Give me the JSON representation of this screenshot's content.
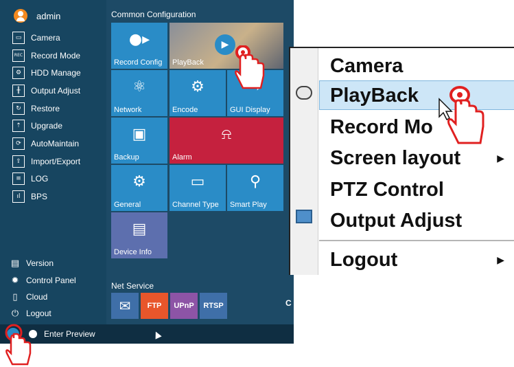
{
  "user": {
    "name": "admin"
  },
  "sidebar": {
    "items": [
      {
        "label": "Camera",
        "icon": "camera-icon",
        "glyph": "▭"
      },
      {
        "label": "Record Mode",
        "icon": "rec-icon",
        "glyph": "REC"
      },
      {
        "label": "HDD Manage",
        "icon": "hdd-icon",
        "glyph": "⚙"
      },
      {
        "label": "Output Adjust",
        "icon": "sliders-icon",
        "glyph": "╫"
      },
      {
        "label": "Restore",
        "icon": "restore-icon",
        "glyph": "↻"
      },
      {
        "label": "Upgrade",
        "icon": "upgrade-icon",
        "glyph": "⇡"
      },
      {
        "label": "AutoMaintain",
        "icon": "automaintain-icon",
        "glyph": "⟳"
      },
      {
        "label": "Import/Export",
        "icon": "import-export-icon",
        "glyph": "⇪"
      },
      {
        "label": "LOG",
        "icon": "log-icon",
        "glyph": "≡"
      },
      {
        "label": "BPS",
        "icon": "bps-icon",
        "glyph": "ıl"
      }
    ],
    "bottom": [
      {
        "label": "Version",
        "icon": "version-icon",
        "glyph": "▤"
      },
      {
        "label": "Control Panel",
        "icon": "gear-icon",
        "glyph": "✹"
      },
      {
        "label": "Cloud",
        "icon": "cloud-icon",
        "glyph": "▯"
      },
      {
        "label": "Logout",
        "icon": "power-icon",
        "glyph": "⏻"
      }
    ]
  },
  "common": {
    "title": "Common Configuration",
    "tiles": [
      {
        "label": "Record Config",
        "icon": "video-camera-icon",
        "glyph": "●▸",
        "color": "#2a8cc7"
      },
      {
        "label": "PlayBack",
        "icon": "play-icon",
        "glyph": "▶",
        "color": "#6b6f78"
      },
      {
        "label": "Network",
        "icon": "network-icon",
        "glyph": "⚛",
        "color": "#2a8cc7"
      },
      {
        "label": "Encode",
        "icon": "encode-icon",
        "glyph": "⚙",
        "color": "#2a8cc7"
      },
      {
        "label": "GUI Display",
        "icon": "display-icon",
        "glyph": "⇨",
        "color": "#2a8cc7"
      },
      {
        "label": "Backup",
        "icon": "floppy-icon",
        "glyph": "▣",
        "color": "#2a8cc7"
      },
      {
        "label": "Alarm",
        "icon": "alarm-icon",
        "glyph": "⍾",
        "color": "#c5213e"
      },
      {
        "label": "General",
        "icon": "general-icon",
        "glyph": "⚙",
        "color": "#2a8cc7"
      },
      {
        "label": "Channel Type",
        "icon": "channel-type-icon",
        "glyph": "▭",
        "color": "#2a8cc7"
      },
      {
        "label": "Smart Play",
        "icon": "search-icon",
        "glyph": "⚲",
        "color": "#2a8cc7"
      },
      {
        "label": "Device Info",
        "icon": "device-info-icon",
        "glyph": "▤",
        "color": "#5d6fae"
      }
    ]
  },
  "net": {
    "title": "Net Service",
    "tiles": [
      {
        "label": "",
        "icon": "mail-icon",
        "glyph": "✉",
        "color": "#3f6fa8"
      },
      {
        "label": "FTP",
        "icon": "ftp-icon",
        "glyph": "",
        "color": "#e8562b"
      },
      {
        "label": "UPnP",
        "icon": "upnp-icon",
        "glyph": "",
        "color": "#8d54a6"
      },
      {
        "label": "RTSP",
        "icon": "rtsp-icon",
        "glyph": "",
        "color": "#3f6fa8"
      }
    ],
    "refresh_glyph": "C"
  },
  "taskbar": {
    "label": "Enter Preview"
  },
  "context_menu": {
    "items": [
      {
        "label": "Camera",
        "arrow": ""
      },
      {
        "label": "PlayBack",
        "arrow": ""
      },
      {
        "label": "Record Mo",
        "arrow": ""
      },
      {
        "label": "Screen layout",
        "arrow": "▶"
      },
      {
        "label": "PTZ Control",
        "arrow": ""
      },
      {
        "label": "Output Adjust",
        "arrow": ""
      },
      {
        "label": "Logout",
        "arrow": "▶"
      }
    ]
  }
}
